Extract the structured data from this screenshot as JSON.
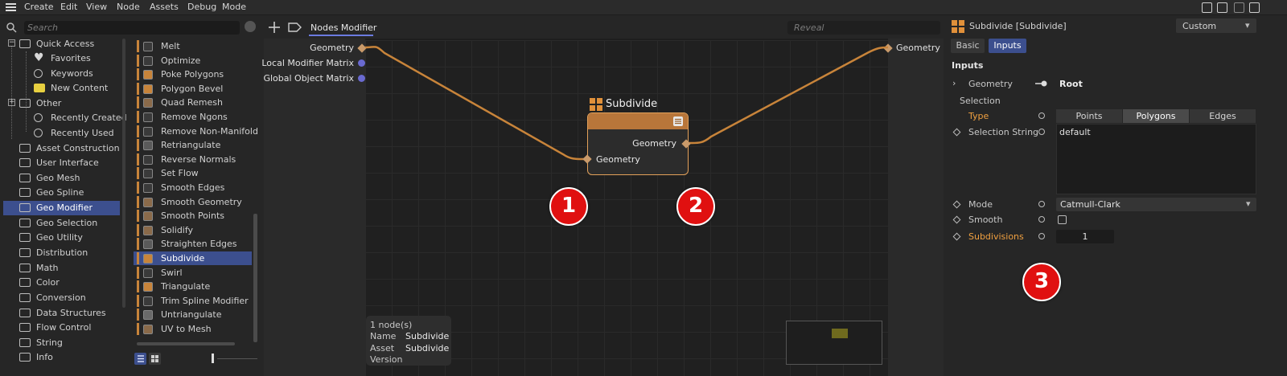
{
  "menu": [
    "Create",
    "Edit",
    "View",
    "Node",
    "Assets",
    "Debug",
    "Mode"
  ],
  "search": {
    "placeholder": "Search"
  },
  "categories": [
    {
      "label": "Quick Access",
      "icon": "folder-icon"
    },
    {
      "label": "Favorites",
      "icon": "heart-icon"
    },
    {
      "label": "Keywords",
      "icon": "search-icon"
    },
    {
      "label": "New Content",
      "icon": "new-icon"
    },
    {
      "label": "Other",
      "icon": "folder-icon"
    },
    {
      "label": "Recently Created",
      "icon": "search-icon"
    },
    {
      "label": "Recently Used",
      "icon": "search-icon"
    },
    {
      "label": "Asset Construction",
      "icon": "folder-icon"
    },
    {
      "label": "User Interface",
      "icon": "folder-icon"
    },
    {
      "label": "Geo Mesh",
      "icon": "folder-icon"
    },
    {
      "label": "Geo Spline",
      "icon": "folder-icon"
    },
    {
      "label": "Geo Modifier",
      "icon": "folder-icon"
    },
    {
      "label": "Geo Selection",
      "icon": "folder-icon"
    },
    {
      "label": "Geo Utility",
      "icon": "folder-icon"
    },
    {
      "label": "Distribution",
      "icon": "folder-icon"
    },
    {
      "label": "Math",
      "icon": "folder-icon"
    },
    {
      "label": "Color",
      "icon": "folder-icon"
    },
    {
      "label": "Conversion",
      "icon": "folder-icon"
    },
    {
      "label": "Data Structures",
      "icon": "folder-icon"
    },
    {
      "label": "Flow Control",
      "icon": "folder-icon"
    },
    {
      "label": "String",
      "icon": "folder-icon"
    },
    {
      "label": "Info",
      "icon": "folder-icon"
    }
  ],
  "nodes": [
    "Melt",
    "Optimize",
    "Poke Polygons",
    "Polygon Bevel",
    "Quad Remesh",
    "Remove Ngons",
    "Remove Non-Manifold",
    "Retriangulate",
    "Reverse Normals",
    "Set Flow",
    "Smooth Edges",
    "Smooth Geometry",
    "Smooth Points",
    "Solidify",
    "Straighten Edges",
    "Subdivide",
    "Swirl",
    "Triangulate",
    "Trim Spline Modifier",
    "Untriangulate",
    "UV to Mesh"
  ],
  "canvas": {
    "tab": "Nodes Modifier",
    "reveal_placeholder": "Reveal",
    "inputs": [
      "Geometry",
      "Local Modifier Matrix",
      "Global Object Matrix"
    ],
    "output": "Geometry",
    "node": {
      "title": "Subdivide",
      "out": "Geometry",
      "in": "Geometry"
    },
    "info": {
      "count": "1 node(s)",
      "name_k": "Name",
      "name_v": "Subdivide",
      "asset_k": "Asset",
      "asset_v": "Subdivide",
      "version_k": "Version"
    },
    "badges": [
      "1",
      "2"
    ]
  },
  "attr": {
    "title": "Subdivide [Subdivide]",
    "preset": "Custom",
    "tabs": [
      "Basic",
      "Inputs"
    ],
    "section": "Inputs",
    "geometry_lbl": "Geometry",
    "geometry_val": "Root",
    "selection": "Selection",
    "type_lbl": "Type",
    "type_opts": [
      "Points",
      "Polygons",
      "Edges"
    ],
    "selstr_lbl": "Selection String",
    "selstr_val": "default",
    "mode_lbl": "Mode",
    "mode_val": "Catmull-Clark",
    "smooth_lbl": "Smooth",
    "subdiv_lbl": "Subdivisions",
    "subdiv_val": "1",
    "badge": "3"
  },
  "colors": {
    "accent": "#3c4f8e",
    "orange": "#c8843a",
    "wire": "#c8843a",
    "highlight_text": "#f0a040"
  }
}
